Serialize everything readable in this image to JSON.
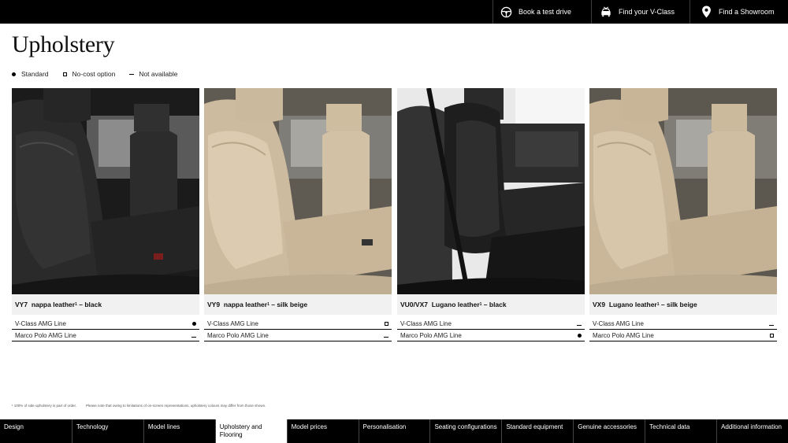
{
  "header": {
    "actions": [
      {
        "label": "Book a test drive",
        "icon": "steering-wheel-icon"
      },
      {
        "label": "Find your V-Class",
        "icon": "car-icon"
      },
      {
        "label": "Find a Showroom",
        "icon": "location-pin-icon"
      }
    ]
  },
  "page_title": "Upholstery",
  "legend": [
    {
      "symbol": "filled-dot",
      "label": "Standard"
    },
    {
      "symbol": "empty-square",
      "label": "No-cost option"
    },
    {
      "symbol": "dash",
      "label": "Not available"
    }
  ],
  "cards": [
    {
      "code": "VY7",
      "name": "nappa leather",
      "footnote_mark": "1",
      "colour": "black",
      "rows": [
        {
          "label": "V-Class AMG Line",
          "value": "filled-dot"
        },
        {
          "label": "Marco Polo AMG Line",
          "value": "dash"
        }
      ]
    },
    {
      "code": "VY9",
      "name": "nappa leather",
      "footnote_mark": "1",
      "colour": "silk beige",
      "rows": [
        {
          "label": "V-Class AMG Line",
          "value": "empty-square"
        },
        {
          "label": "Marco Polo AMG Line",
          "value": "dash"
        }
      ]
    },
    {
      "code": "VU0/VX7",
      "name": "Lugano leather",
      "footnote_mark": "1",
      "colour": "black",
      "rows": [
        {
          "label": "V-Class AMG Line",
          "value": "dash"
        },
        {
          "label": "Marco Polo AMG Line",
          "value": "filled-dot"
        }
      ]
    },
    {
      "code": "VX9",
      "name": "Lugano leather",
      "footnote_mark": "1",
      "colour": "silk beige",
      "rows": [
        {
          "label": "V-Class AMG Line",
          "value": "dash"
        },
        {
          "label": "Marco Polo AMG Line",
          "value": "empty-square"
        }
      ]
    }
  ],
  "footnotes": [
    "¹ 100% of side upholstery is part of order.",
    "Please note that owing to limitations of on-screen representations, upholstery colours may differ from those shown."
  ],
  "bottom_nav": [
    {
      "label": "Design",
      "active": false
    },
    {
      "label": "Technology",
      "active": false
    },
    {
      "label": "Model lines",
      "active": false
    },
    {
      "label": "Upholstery and Flooring",
      "active": true
    },
    {
      "label": "Model prices",
      "active": false
    },
    {
      "label": "Personalisation",
      "active": false
    },
    {
      "label": "Seating configurations",
      "active": false
    },
    {
      "label": "Standard equipment",
      "active": false
    },
    {
      "label": "Genuine accessories",
      "active": false
    },
    {
      "label": "Technical data",
      "active": false
    },
    {
      "label": "Additional information",
      "active": false
    }
  ],
  "colors": {
    "black_leather": "#2b2b2b",
    "silk_beige": "#d9c7ae",
    "bar": "#000000",
    "card_label_bg": "#f1f1f1"
  }
}
